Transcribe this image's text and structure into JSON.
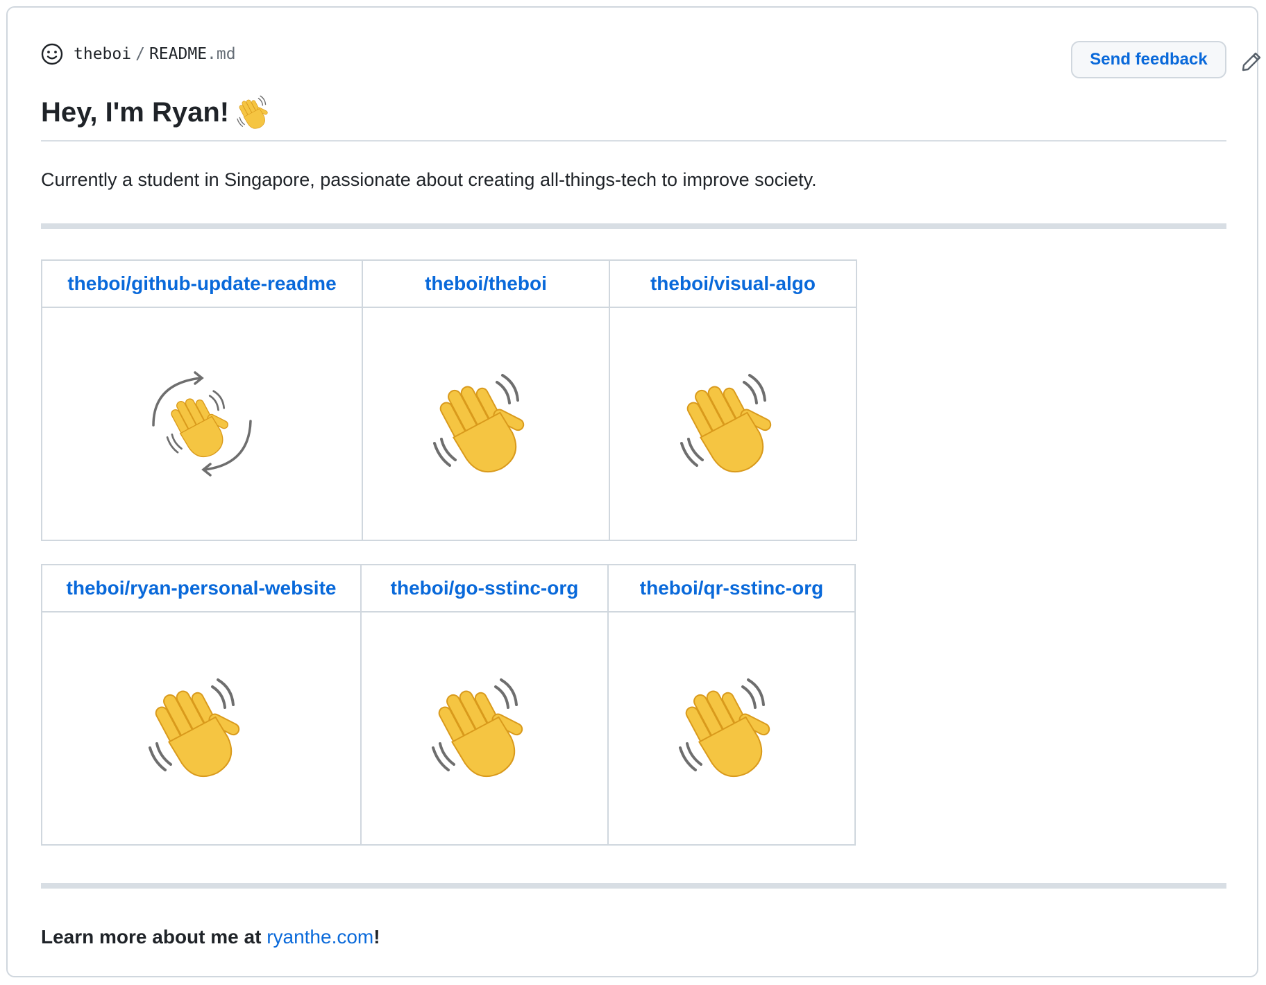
{
  "header": {
    "owner": "theboi",
    "separator": "/",
    "file_name": "README",
    "file_ext": ".md",
    "feedback_label": "Send feedback"
  },
  "readme": {
    "title": "Hey, I'm Ryan!",
    "intro": "Currently a student in Singapore, passionate about creating all-things-tech to improve society.",
    "table1": [
      {
        "repo": "theboi/github-update-readme",
        "image": "rotating-waving-hand"
      },
      {
        "repo": "theboi/theboi",
        "image": "waving-hand"
      },
      {
        "repo": "theboi/visual-algo",
        "image": "waving-hand"
      }
    ],
    "table2": [
      {
        "repo": "theboi/ryan-personal-website",
        "image": "waving-hand"
      },
      {
        "repo": "theboi/go-sstinc-org",
        "image": "waving-hand"
      },
      {
        "repo": "theboi/qr-sstinc-org",
        "image": "waving-hand"
      }
    ],
    "footer_prefix": "Learn more about me at ",
    "footer_link": "ryanthe.com",
    "footer_suffix": "!"
  },
  "colors": {
    "link": "#0969da",
    "text": "#1f2328",
    "border": "#d0d7de",
    "hand": "#f5c542"
  }
}
